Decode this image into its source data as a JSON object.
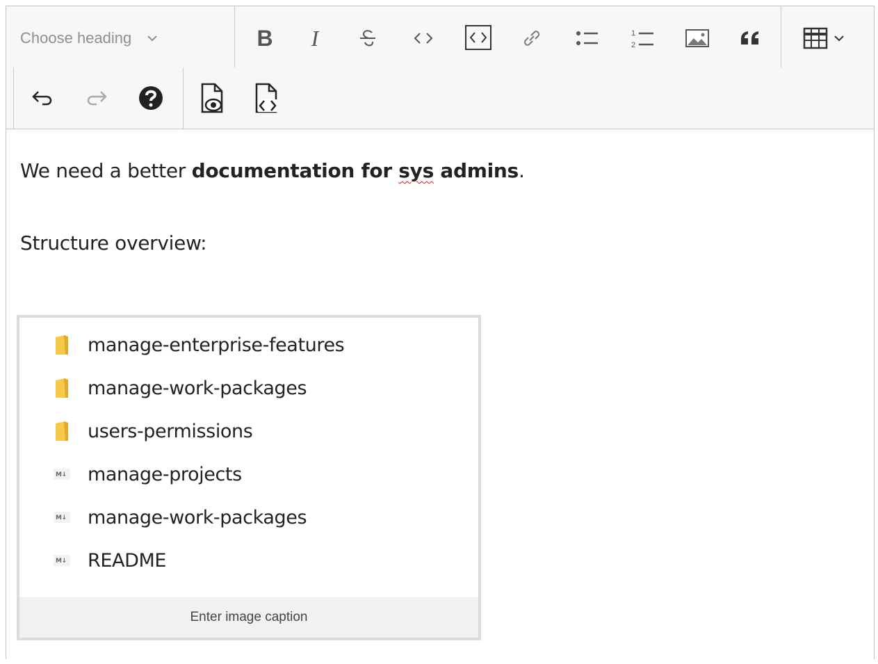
{
  "toolbar": {
    "heading_label": "Choose heading"
  },
  "content": {
    "p1_plain": "We need a better ",
    "p1_bold_a": "documentation for ",
    "p1_bold_b": "sys",
    "p1_bold_c": " admins",
    "p1_end": ".",
    "p2": "Structure overview:"
  },
  "figure": {
    "items": [
      {
        "icon": "folder-icon",
        "name": "manage-enterprise-features"
      },
      {
        "icon": "folder-icon",
        "name": "manage-work-packages"
      },
      {
        "icon": "folder-icon",
        "name": "users-permissions"
      },
      {
        "icon": "markdown-file-icon",
        "name": "manage-projects"
      },
      {
        "icon": "markdown-file-icon",
        "name": "manage-work-packages"
      },
      {
        "icon": "markdown-file-icon",
        "name": "README"
      }
    ],
    "caption_placeholder": "Enter image caption"
  },
  "colors": {
    "toolbar_bg": "#f7f7f7",
    "folder": "#f7c948",
    "spellcheck": "#dd1111"
  }
}
